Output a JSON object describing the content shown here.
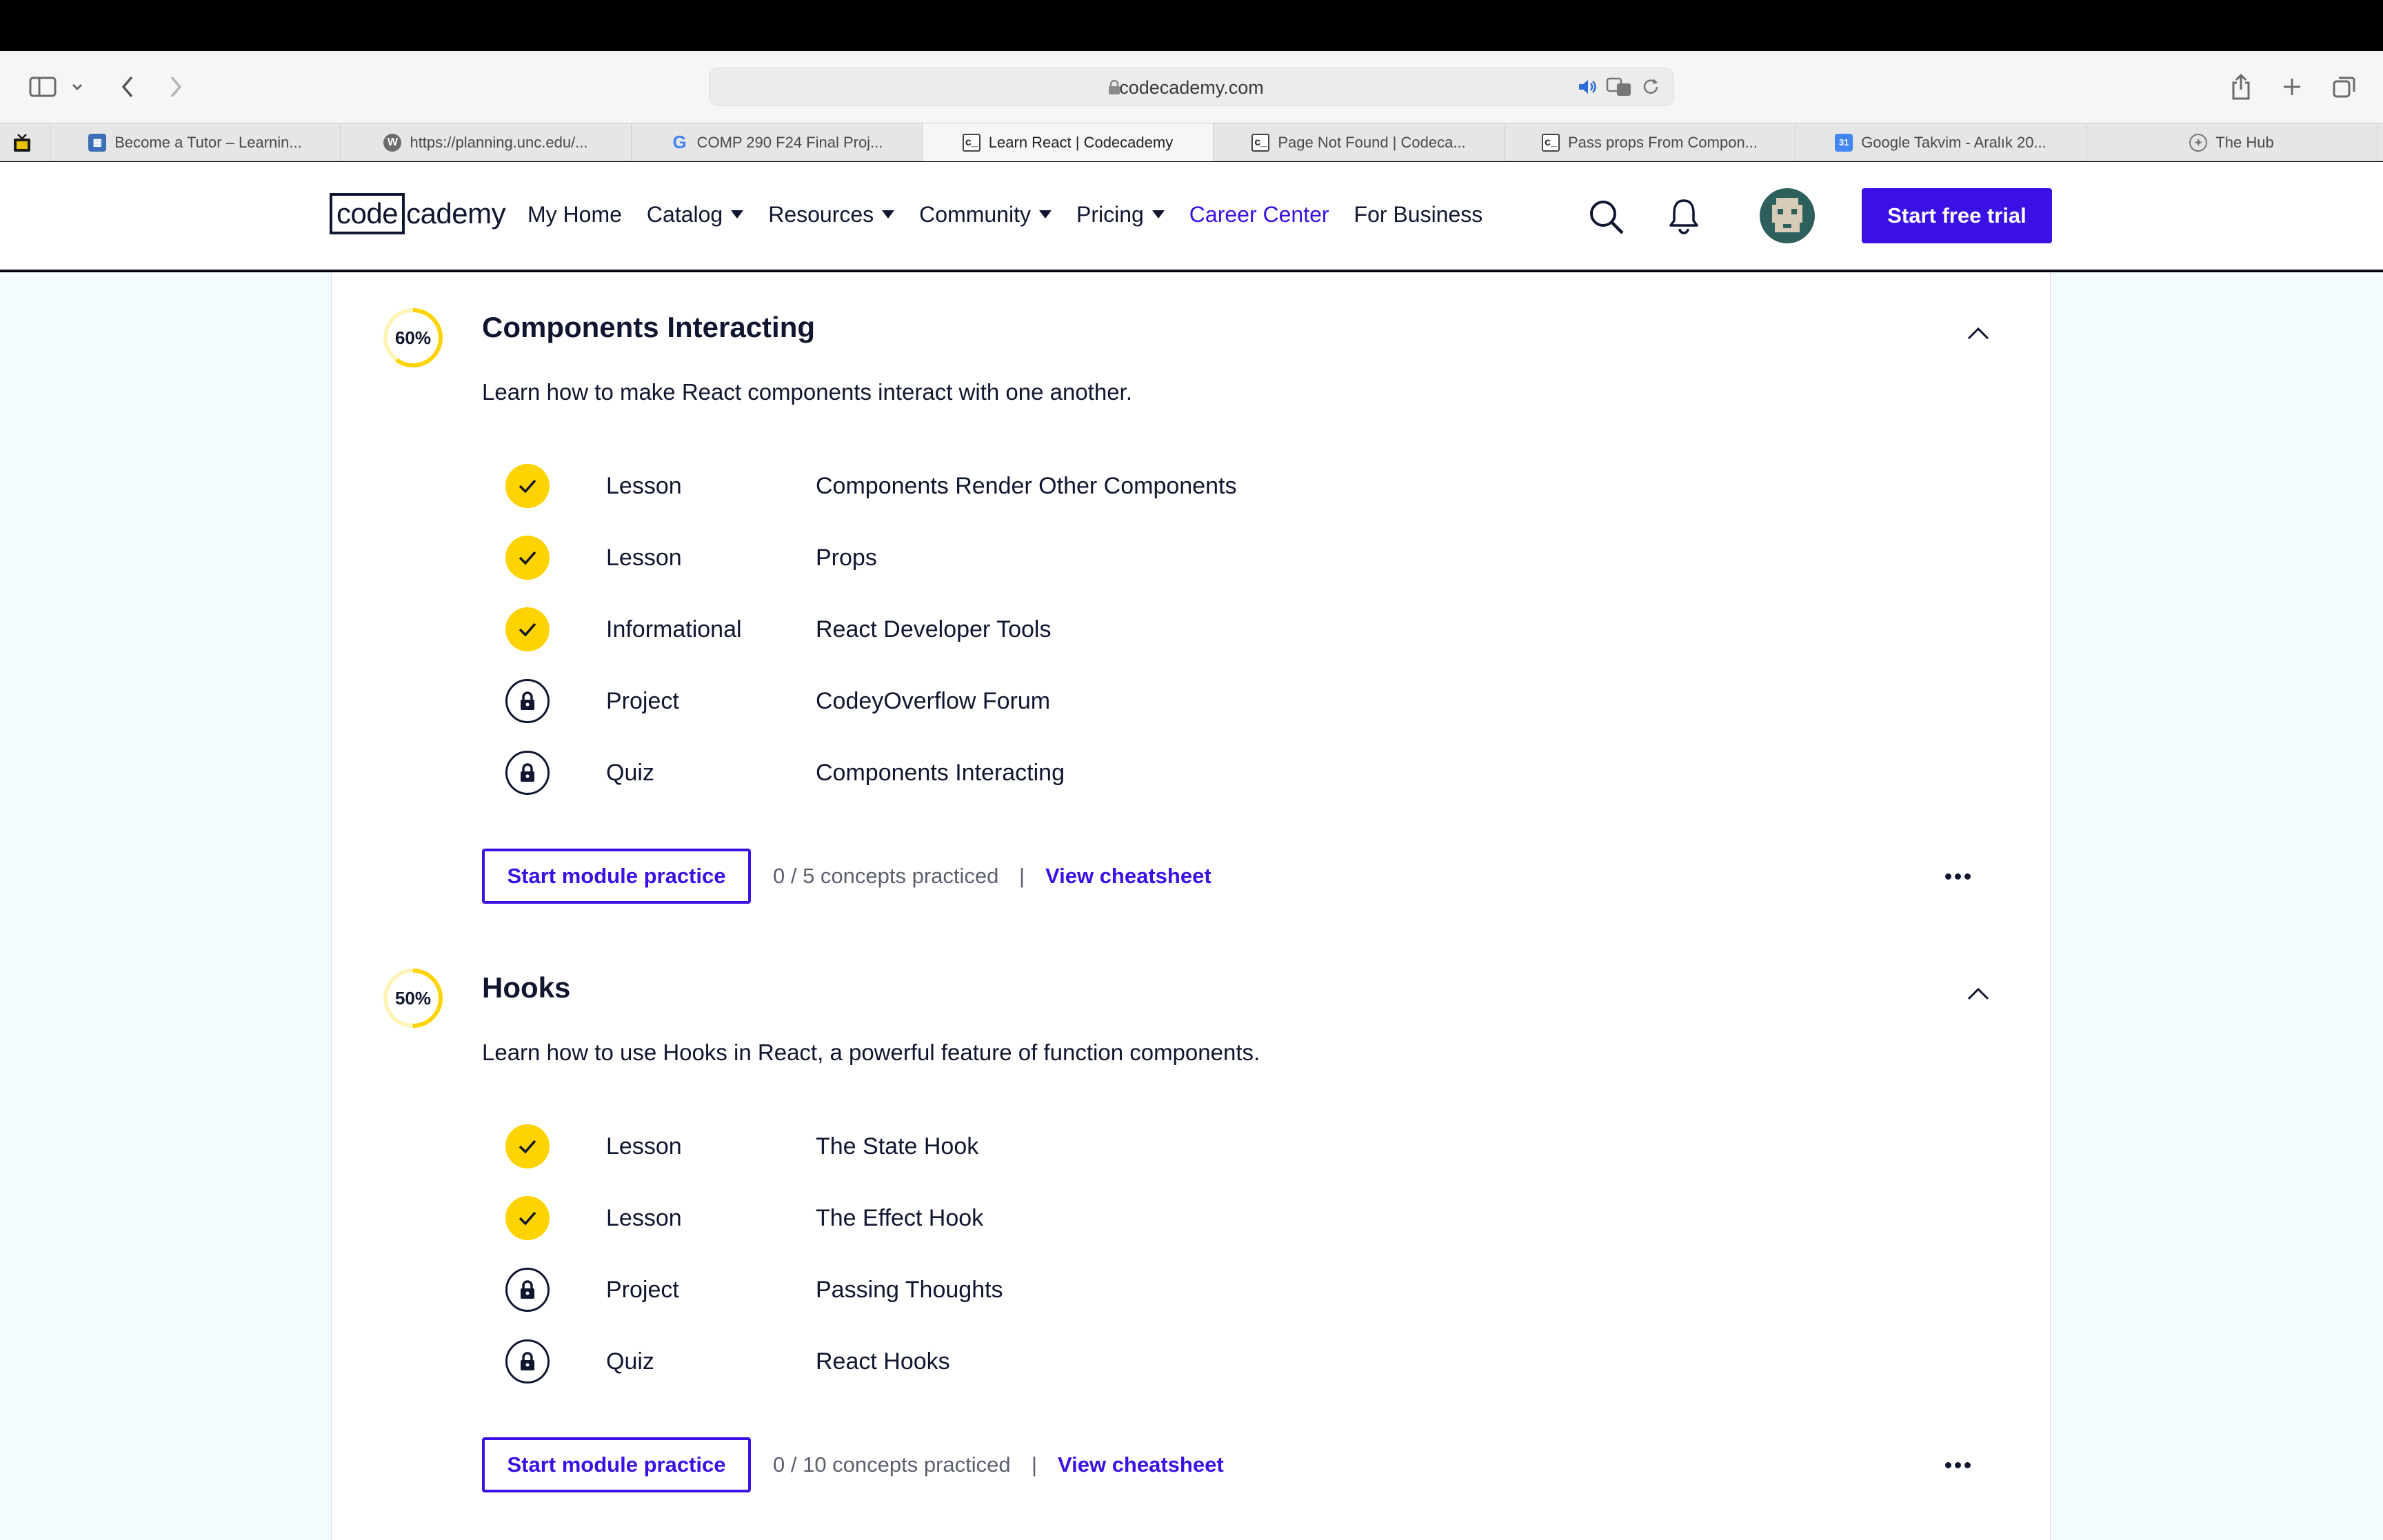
{
  "browser": {
    "url": "codecademy.com",
    "tabs": [
      {
        "label": "Become a Tutor – Learnin...",
        "icon": "tutor-favicon",
        "active": false
      },
      {
        "label": "https://planning.unc.edu/...",
        "icon": "wordpress-favicon",
        "active": false
      },
      {
        "label": "COMP 290 F24 Final Proj...",
        "icon": "google-favicon",
        "active": false
      },
      {
        "label": "Learn React | Codecademy",
        "icon": "codecademy-favicon",
        "active": true
      },
      {
        "label": "Page Not Found | Codeca...",
        "icon": "codecademy-favicon",
        "active": false
      },
      {
        "label": "Pass props From Compon...",
        "icon": "codecademy-favicon",
        "active": false
      },
      {
        "label": "Google Takvim - Aralık 20...",
        "icon": "google-calendar-favicon",
        "active": false
      },
      {
        "label": "The Hub",
        "icon": "hub-favicon",
        "active": false
      }
    ]
  },
  "header": {
    "logo_boxed": "code",
    "logo_rest": "cademy",
    "nav": {
      "my_home": "My Home",
      "catalog": "Catalog",
      "resources": "Resources",
      "community": "Community",
      "pricing": "Pricing",
      "career_center": "Career Center",
      "for_business": "For Business"
    },
    "cta": "Start free trial"
  },
  "modules": [
    {
      "progress_label": "60%",
      "progress": 0.6,
      "title": "Components Interacting",
      "description": "Learn how to make React components interact with one another.",
      "items": [
        {
          "type": "Lesson",
          "title": "Components Render Other Components",
          "status": "complete"
        },
        {
          "type": "Lesson",
          "title": "Props",
          "status": "complete"
        },
        {
          "type": "Informational",
          "title": "React Developer Tools",
          "status": "complete"
        },
        {
          "type": "Project",
          "title": "CodeyOverflow Forum",
          "status": "locked"
        },
        {
          "type": "Quiz",
          "title": "Components Interacting",
          "status": "locked"
        }
      ],
      "practice_button": "Start module practice",
      "practiced": "0 / 5 concepts practiced",
      "separator": "|",
      "cheatsheet": "View cheatsheet"
    },
    {
      "progress_label": "50%",
      "progress": 0.5,
      "title": "Hooks",
      "description": "Learn how to use Hooks in React, a powerful feature of function components.",
      "items": [
        {
          "type": "Lesson",
          "title": "The State Hook",
          "status": "complete"
        },
        {
          "type": "Lesson",
          "title": "The Effect Hook",
          "status": "complete"
        },
        {
          "type": "Project",
          "title": "Passing Thoughts",
          "status": "locked"
        },
        {
          "type": "Quiz",
          "title": "React Hooks",
          "status": "locked"
        }
      ],
      "practice_button": "Start module practice",
      "practiced": "0 / 10 concepts practiced",
      "separator": "|",
      "cheatsheet": "View cheatsheet"
    }
  ],
  "colors": {
    "brand": "#3a10e5",
    "navy": "#10162f",
    "complete": "#ffd300",
    "ring_track": "#fff3b8",
    "page_bg": "#f5fcff"
  }
}
